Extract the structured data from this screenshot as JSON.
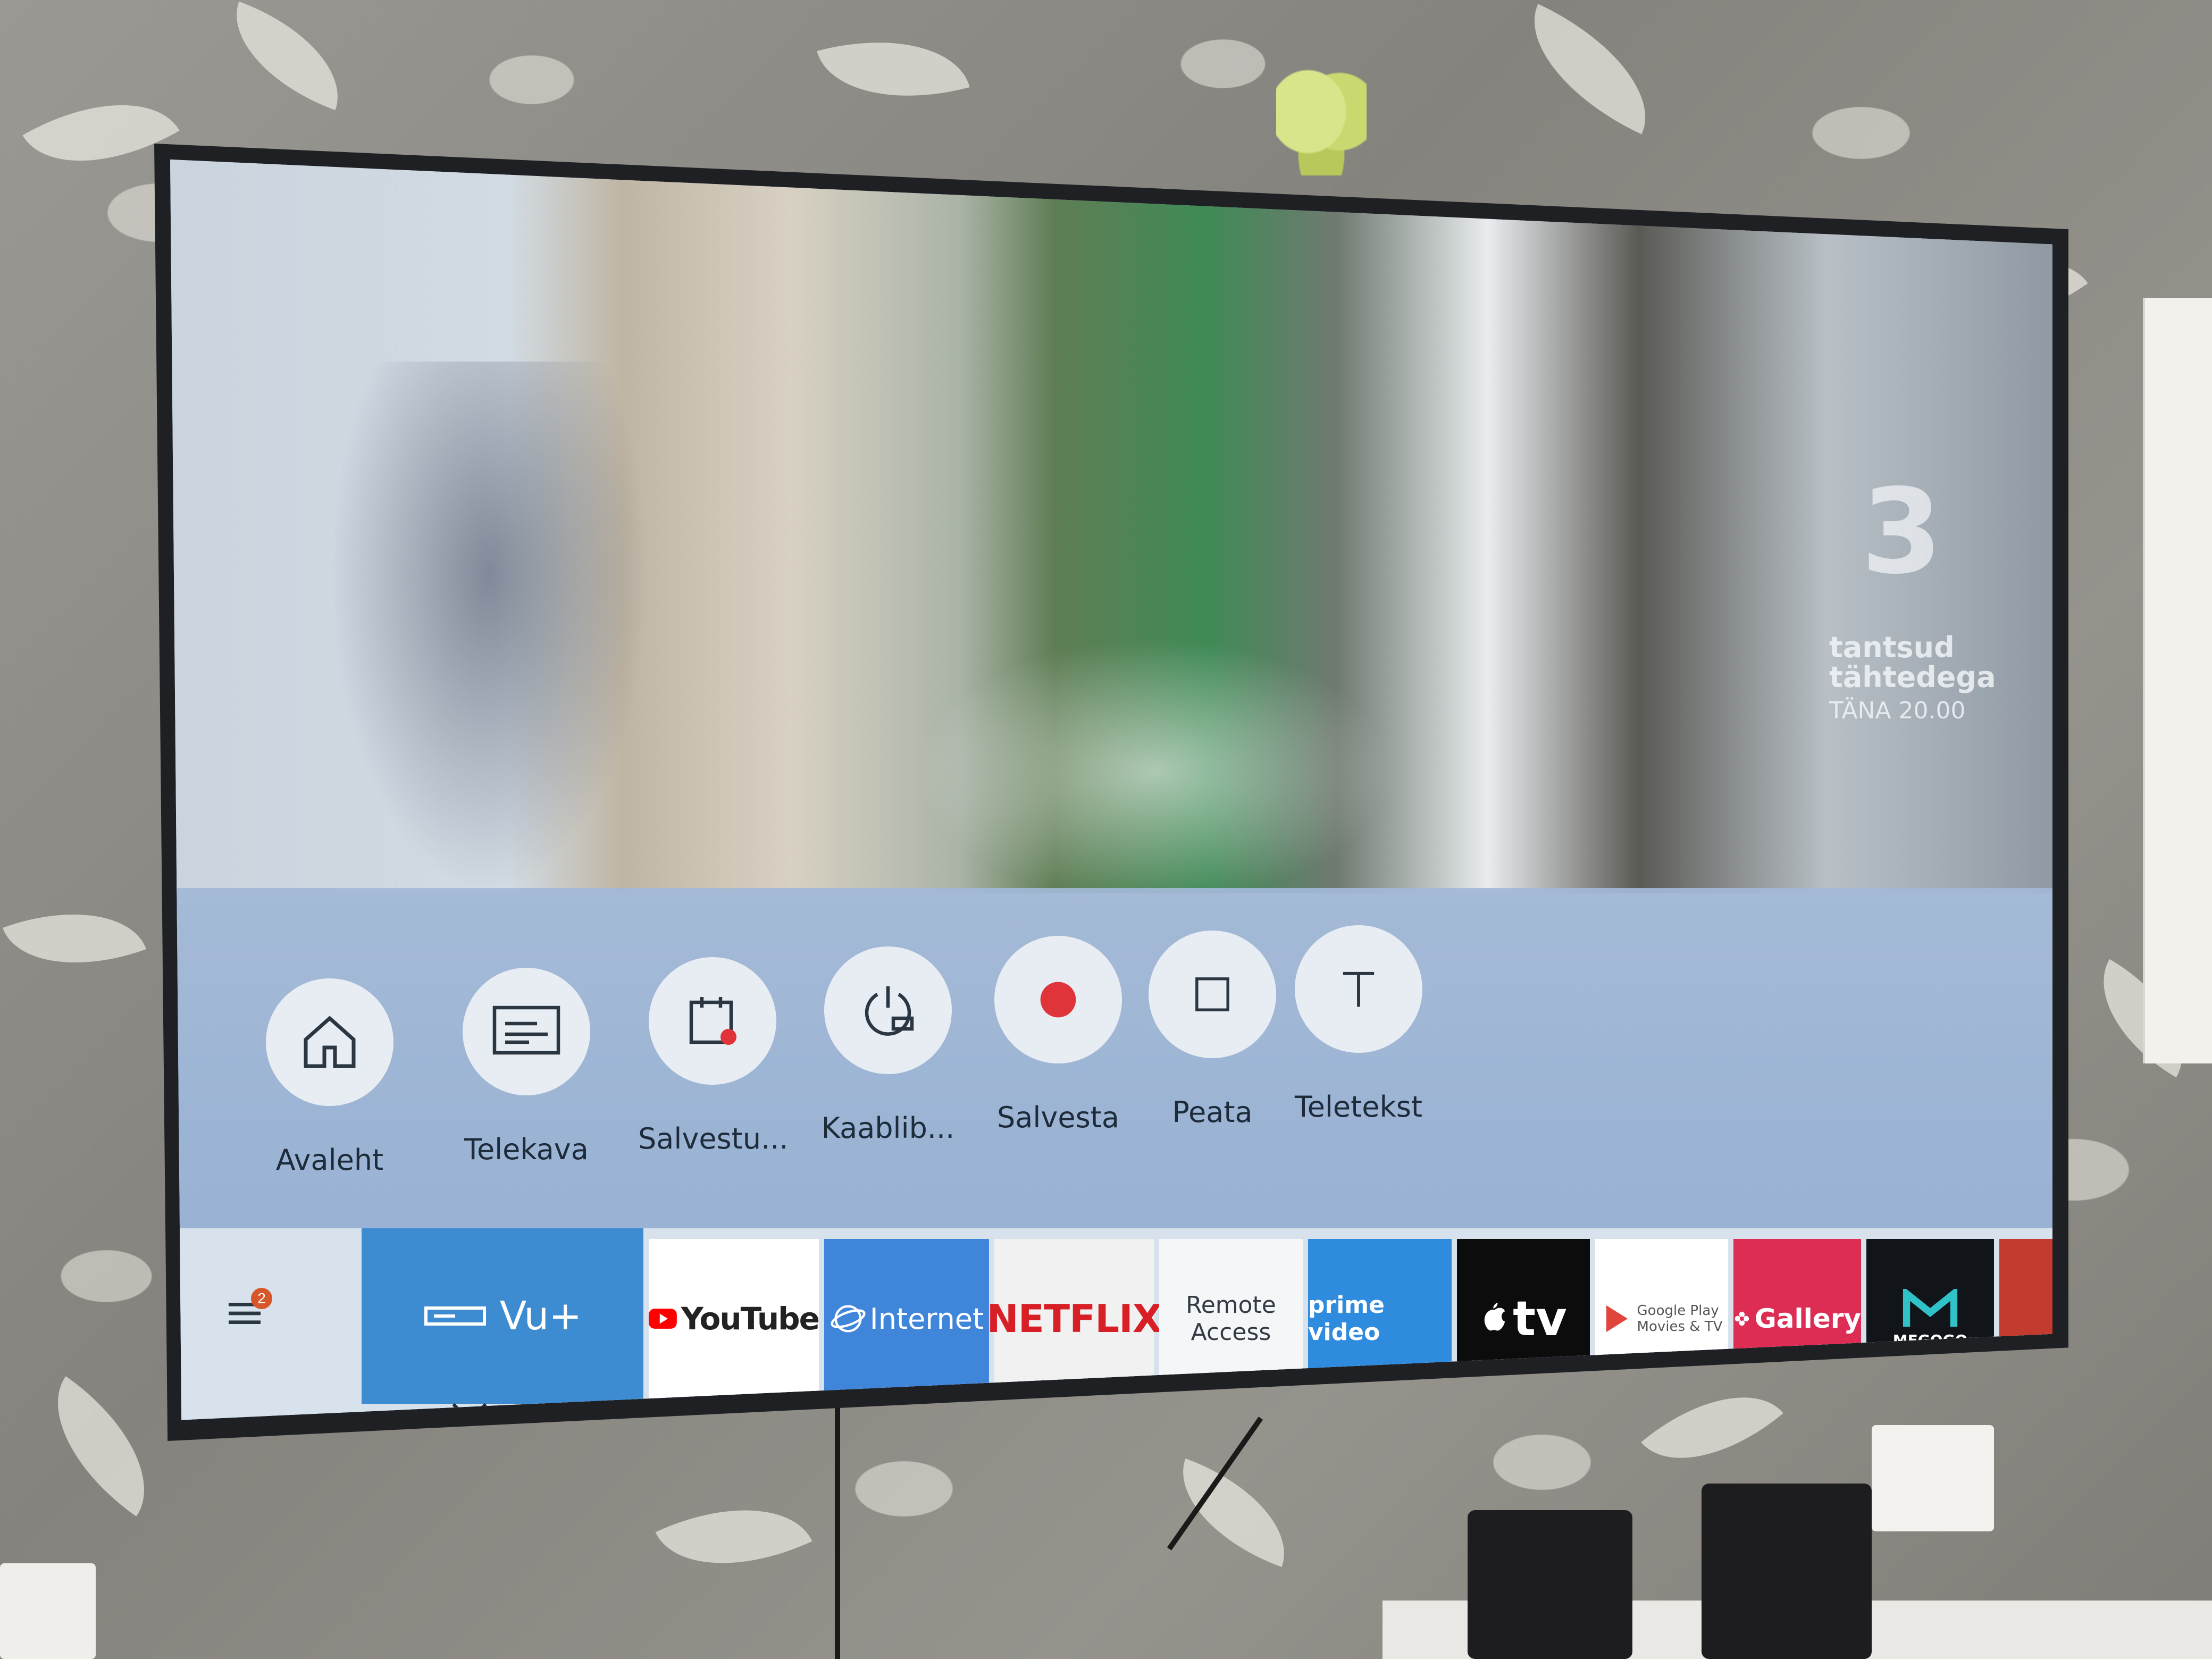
{
  "channel": {
    "logo": "3",
    "promo_line1": "tantsud",
    "promo_line2": "tähtedega",
    "promo_line3": "TÄNA 20.00"
  },
  "quick_actions": [
    {
      "id": "home",
      "label": "Avaleht",
      "icon": "home-icon"
    },
    {
      "id": "guide",
      "label": "Telekava",
      "icon": "guide-icon"
    },
    {
      "id": "recordings",
      "label": "Salvestu...",
      "icon": "calendar-record-icon"
    },
    {
      "id": "cable",
      "label": "Kaablib...",
      "icon": "power-timer-icon"
    },
    {
      "id": "record",
      "label": "Salvesta",
      "icon": "record-icon"
    },
    {
      "id": "stop",
      "label": "Peata",
      "icon": "stop-icon"
    },
    {
      "id": "teletext",
      "label": "Teletekst",
      "icon": "teletext-icon"
    }
  ],
  "menu": {
    "badge": "2",
    "icon": "hamburger-icon"
  },
  "apps": [
    {
      "id": "vu",
      "label": "Vu+",
      "selected": true,
      "bg": "#3d8bd0",
      "color": "#ffffff"
    },
    {
      "id": "youtube",
      "label": "YouTube",
      "bg": "#ffffff",
      "color": "#222222"
    },
    {
      "id": "internet",
      "label": "Internet",
      "bg": "#3f86db",
      "color": "#ffffff"
    },
    {
      "id": "netflix",
      "label": "NETFLIX",
      "bg": "#f1f1f1",
      "color": "#d81f26"
    },
    {
      "id": "remote",
      "label_line1": "Remote",
      "label_line2": "Access",
      "bg": "#f4f6f8",
      "color": "#333a44"
    },
    {
      "id": "prime",
      "label": "prime video",
      "bg": "#2f8bde",
      "color": "#ffffff"
    },
    {
      "id": "appletv",
      "label": "tv",
      "bg": "#0c0c0c",
      "color": "#ffffff"
    },
    {
      "id": "googleplay",
      "label_line1": "Google Play",
      "label_line2": "Movies & TV",
      "bg": "#ffffff",
      "color": "#555555"
    },
    {
      "id": "gallery",
      "label": "Gallery",
      "bg": "#dd2d54",
      "color": "#ffffff"
    },
    {
      "id": "megogo",
      "label": "MEGOGO",
      "bg": "#111418",
      "color": "#ffffff"
    }
  ]
}
